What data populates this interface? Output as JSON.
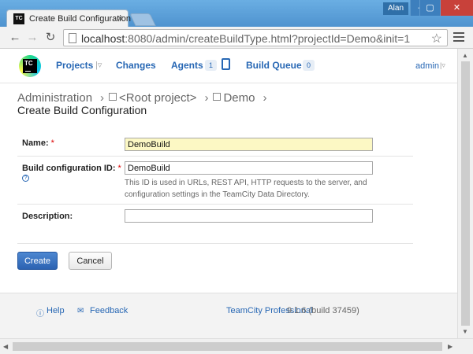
{
  "browser": {
    "tab_title": "Create Build Configuration",
    "tab_close": "×",
    "tab_favicon": "TC",
    "user_label": "Alan",
    "window_buttons": {
      "minimize": "‒",
      "maximize": "▢",
      "close": "✕"
    },
    "url_host": "localhost",
    "url_rest": ":8080/admin/createBuildType.html?projectId=Demo&init=1"
  },
  "header": {
    "logo_text": "TC",
    "nav": {
      "projects": "Projects",
      "changes": "Changes",
      "agents": "Agents",
      "agents_count": "1",
      "build_queue": "Build Queue",
      "build_queue_count": "0"
    },
    "user": "admin"
  },
  "breadcrumb": {
    "items": [
      "Administration",
      "<Root project>",
      "Demo"
    ]
  },
  "page_title": "Create Build Configuration",
  "form": {
    "name_label": "Name:",
    "name_value": "DemoBuild",
    "id_label": "Build configuration ID:",
    "id_value": "DemoBuild",
    "id_note": "This ID is used in URLs, REST API, HTTP requests to the server, and configuration settings in the TeamCity Data Directory.",
    "description_label": "Description:",
    "description_value": "",
    "required_marker": "*",
    "help_marker": "?"
  },
  "buttons": {
    "create": "Create",
    "cancel": "Cancel"
  },
  "footer": {
    "help": "Help",
    "feedback": "Feedback",
    "product": "TeamCity Professional",
    "version": "9.1.6 (build 37459)"
  },
  "colors": {
    "accent": "#2767b4",
    "required": "#dd0000",
    "highlight_field": "#fcf8c4"
  }
}
